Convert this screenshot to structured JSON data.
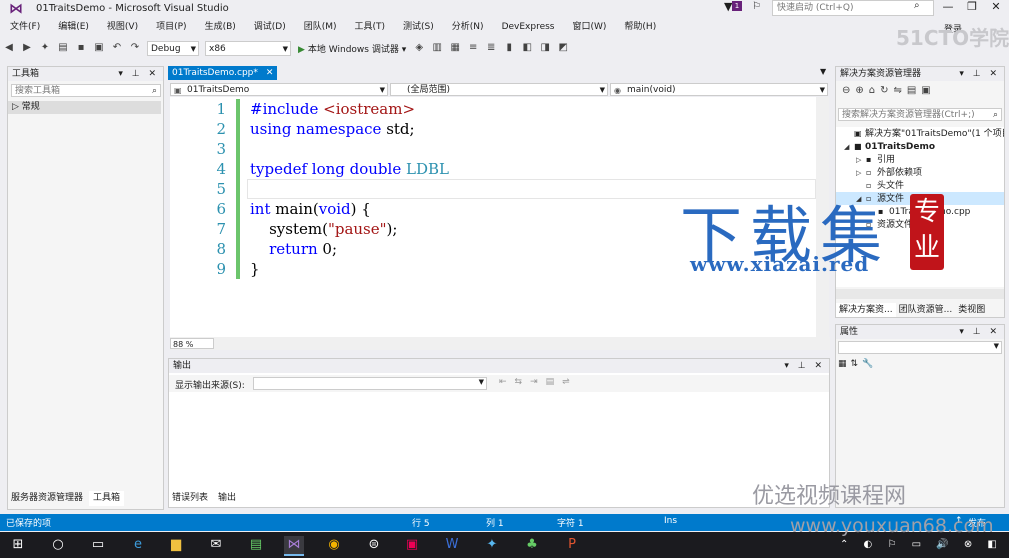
{
  "window": {
    "title": "01TraitsDemo - Microsoft Visual Studio",
    "notification_count": "1",
    "quick_launch_placeholder": "快速启动 (Ctrl+Q)",
    "sign_in": "登录"
  },
  "menu": [
    "文件(F)",
    "编辑(E)",
    "视图(V)",
    "项目(P)",
    "生成(B)",
    "调试(D)",
    "团队(M)",
    "工具(T)",
    "测试(S)",
    "分析(N)",
    "DevExpress",
    "窗口(W)",
    "帮助(H)"
  ],
  "toolbar": {
    "config": "Debug",
    "platform": "x86",
    "run_label": "本地 Windows 调试器"
  },
  "toolbox": {
    "title": "工具箱",
    "search_placeholder": "搜索工具箱",
    "group": "常规",
    "tabs": [
      "服务器资源管理器",
      "工具箱"
    ]
  },
  "editor": {
    "tab_label": "01TraitsDemo.cpp*",
    "nav_project": "01TraitsDemo",
    "nav_scope": "(全局范围)",
    "nav_function": "main(void)",
    "zoom": "88 %",
    "line_numbers": [
      "1",
      "2",
      "3",
      "4",
      "5",
      "6",
      "7",
      "8",
      "9"
    ],
    "code": [
      {
        "parts": [
          {
            "t": "#include ",
            "c": "kw"
          },
          {
            "t": "<iostream>",
            "c": "str"
          }
        ]
      },
      {
        "parts": [
          {
            "t": "using namespace ",
            "c": "kw"
          },
          {
            "t": "std;",
            "c": ""
          }
        ]
      },
      {
        "parts": []
      },
      {
        "parts": [
          {
            "t": "typedef long double ",
            "c": "kw"
          },
          {
            "t": "LDBL",
            "c": "typ"
          }
        ]
      },
      {
        "parts": []
      },
      {
        "parts": [
          {
            "t": "int",
            "c": "kw"
          },
          {
            "t": " main(",
            "c": ""
          },
          {
            "t": "void",
            "c": "kw"
          },
          {
            "t": ") {",
            "c": ""
          }
        ]
      },
      {
        "parts": [
          {
            "t": "    system(",
            "c": ""
          },
          {
            "t": "\"pause\"",
            "c": "str"
          },
          {
            "t": ");",
            "c": ""
          }
        ]
      },
      {
        "parts": [
          {
            "t": "    ",
            "c": ""
          },
          {
            "t": "return",
            "c": "kw"
          },
          {
            "t": " 0;",
            "c": ""
          }
        ]
      },
      {
        "parts": [
          {
            "t": "}",
            "c": ""
          }
        ]
      }
    ]
  },
  "output": {
    "title": "输出",
    "source_label": "显示输出来源(S):",
    "tabs": [
      "错误列表",
      "输出"
    ]
  },
  "solution": {
    "title": "解决方案资源管理器",
    "search_placeholder": "搜索解决方案资源管理器(Ctrl+;)",
    "tree": [
      {
        "label": "解决方案\"01TraitsDemo\"(1 个项目)",
        "indent": 0,
        "twisty": "",
        "icon": "▣"
      },
      {
        "label": "01TraitsDemo",
        "indent": 0,
        "twisty": "◢",
        "icon": "■",
        "bold": true
      },
      {
        "label": "引用",
        "indent": 1,
        "twisty": "▷",
        "icon": "▪"
      },
      {
        "label": "外部依赖项",
        "indent": 1,
        "twisty": "▷",
        "icon": "▫"
      },
      {
        "label": "头文件",
        "indent": 1,
        "twisty": "",
        "icon": "▫"
      },
      {
        "label": "源文件",
        "indent": 1,
        "twisty": "◢",
        "icon": "▫",
        "selected": true
      },
      {
        "label": "01TraitsDemo.cpp",
        "indent": 2,
        "twisty": "",
        "icon": "▪"
      },
      {
        "label": "资源文件",
        "indent": 1,
        "twisty": "",
        "icon": "▫"
      }
    ],
    "tabs": [
      "解决方案资...",
      "团队资源管...",
      "类视图"
    ]
  },
  "properties": {
    "title": "属性"
  },
  "status": {
    "left": "已保存的项",
    "line": "行 5",
    "col": "列 1",
    "char": "字符 1",
    "ins": "Ins",
    "publish": "发布"
  },
  "watermarks": {
    "big": "下载集",
    "seal": "专业",
    "url": "www.xiazai.red",
    "corner": "51CTO学院",
    "course": "优选视频课程网",
    "site": "www.youxuan68.com"
  },
  "colors": {
    "accent": "#007acc",
    "vs_purple": "#68217a",
    "change_bar": "#6cc56c"
  }
}
